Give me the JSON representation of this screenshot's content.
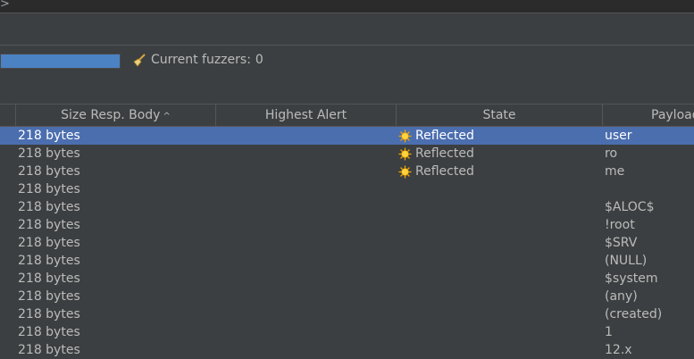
{
  "top": {
    "chevron_icon": "chevron-right-icon",
    "chevron_glyph": ">"
  },
  "progress": {
    "fraction": 1.0,
    "color": "#4b82c4"
  },
  "fuzzers": {
    "label": "Current fuzzers:",
    "count": "0",
    "icon": "broom-icon"
  },
  "table": {
    "columns": [
      {
        "label": ""
      },
      {
        "label": "Size Resp. Body",
        "sort": "ascending"
      },
      {
        "label": "Highest Alert"
      },
      {
        "label": "State"
      },
      {
        "label": "Payload"
      }
    ],
    "sort_glyph": "^",
    "rows": [
      {
        "size": "218 bytes",
        "state": "Reflected",
        "payload": "user",
        "selected": true
      },
      {
        "size": "218 bytes",
        "state": "Reflected",
        "payload": "ro"
      },
      {
        "size": "218 bytes",
        "state": "Reflected",
        "payload": "me"
      },
      {
        "size": "218 bytes",
        "state": "",
        "payload": ""
      },
      {
        "size": "218 bytes",
        "state": "",
        "payload": "$ALOC$"
      },
      {
        "size": "218 bytes",
        "state": "",
        "payload": "!root"
      },
      {
        "size": "218 bytes",
        "state": "",
        "payload": "$SRV"
      },
      {
        "size": "218 bytes",
        "state": "",
        "payload": "(NULL)"
      },
      {
        "size": "218 bytes",
        "state": "",
        "payload": "$system"
      },
      {
        "size": "218 bytes",
        "state": "",
        "payload": "(any)"
      },
      {
        "size": "218 bytes",
        "state": "",
        "payload": "(created)"
      },
      {
        "size": "218 bytes",
        "state": "",
        "payload": "1"
      },
      {
        "size": "218 bytes",
        "state": "",
        "payload": "12.x"
      }
    ]
  },
  "colors": {
    "background": "#3c3f41",
    "selection": "#4b6eaf",
    "text": "#bbbbbb",
    "reflected_icon": "#f5c518"
  }
}
